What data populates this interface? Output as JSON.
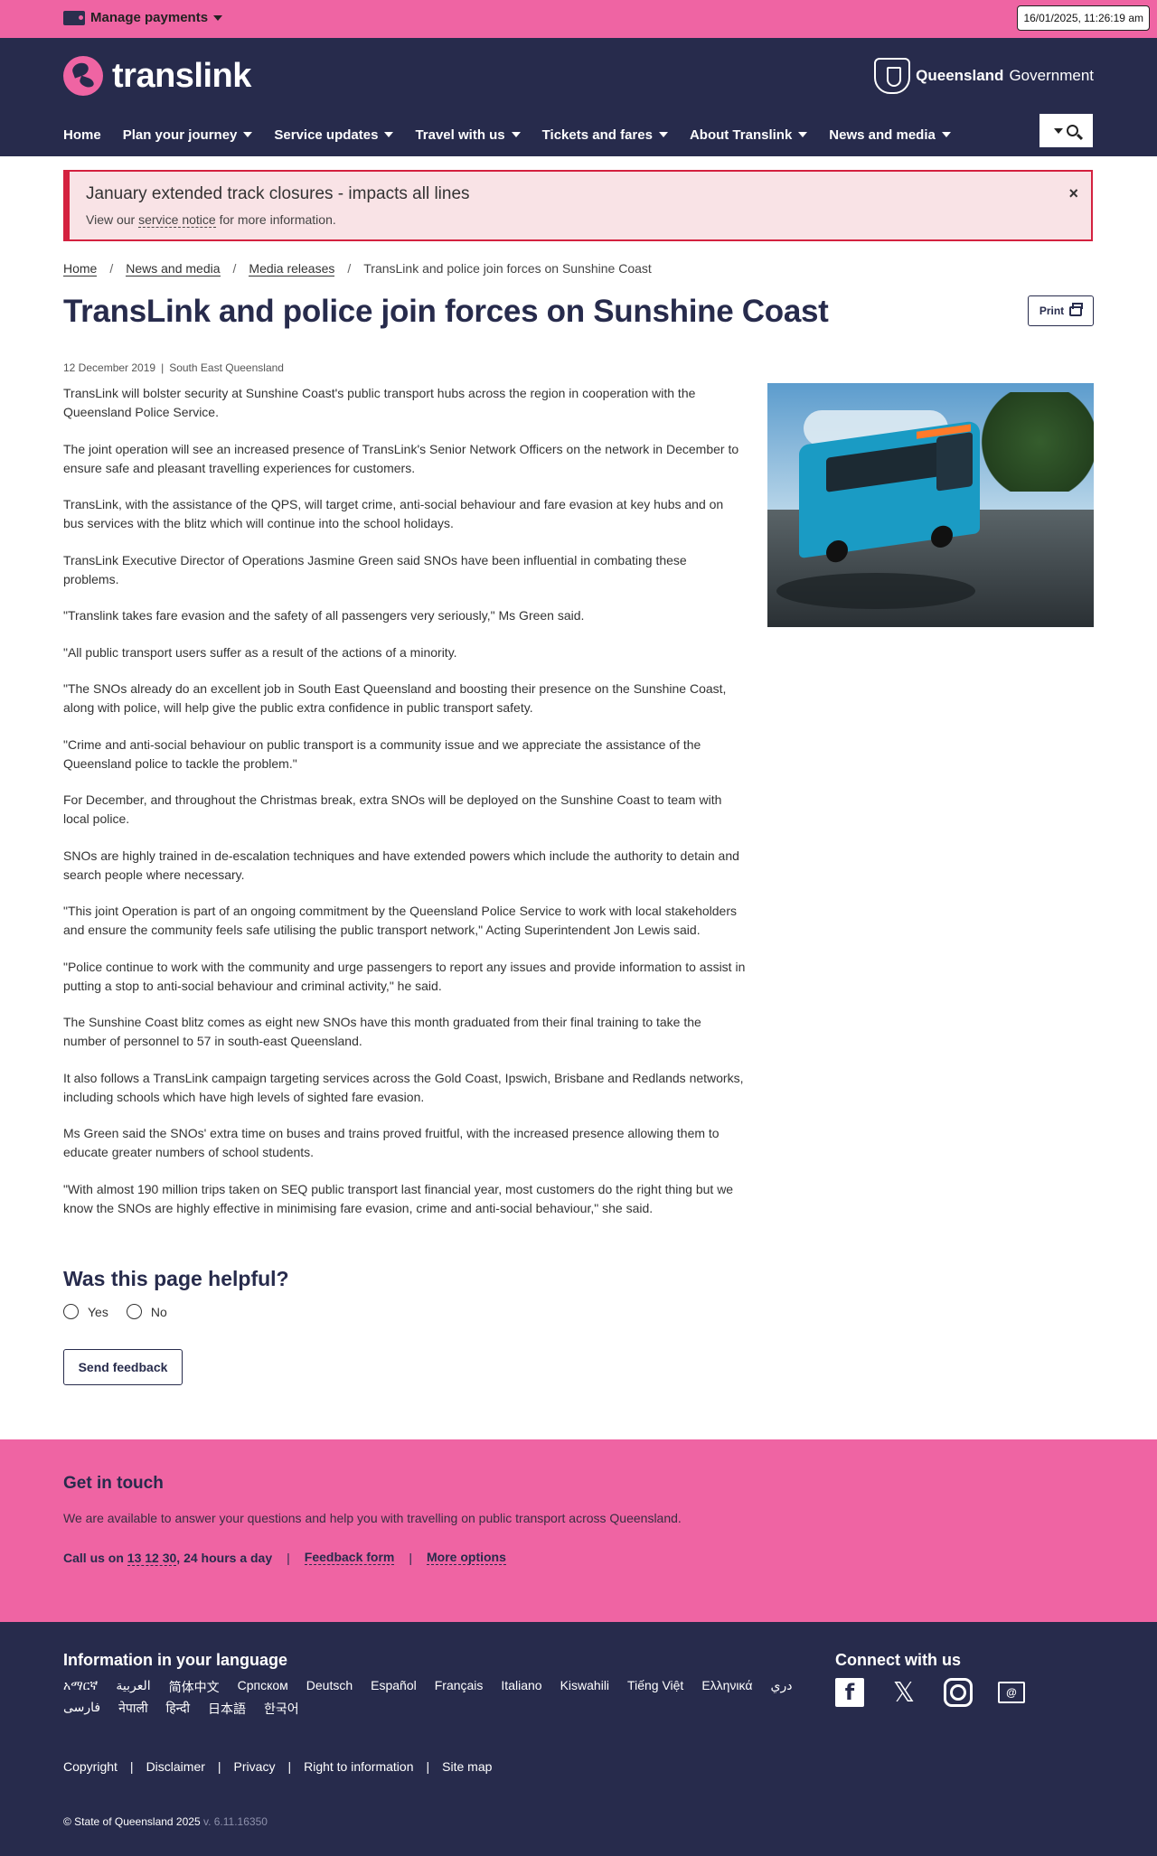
{
  "topbar": {
    "manage_payments": "Manage payments",
    "datetime": "16/01/2025, 11:26:19 am"
  },
  "header": {
    "logo_text": "translink",
    "gov_bold": "Queensland",
    "gov_rest": "Government",
    "nav": [
      "Home",
      "Plan your journey",
      "Service updates",
      "Travel with us",
      "Tickets and fares",
      "About Translink",
      "News and media"
    ]
  },
  "alert": {
    "title": "January extended track closures - impacts all lines",
    "text_before": "View our ",
    "link": "service notice",
    "text_after": " for more information.",
    "close": "×"
  },
  "breadcrumb": {
    "home": "Home",
    "news": "News and media",
    "releases": "Media releases",
    "current": "TransLink and police join forces on Sunshine Coast"
  },
  "article": {
    "title": "TransLink and police join forces on Sunshine Coast",
    "print_label": "Print",
    "date": "12 December 2019",
    "region": "South East Queensland",
    "paragraphs": [
      "TransLink will bolster security at Sunshine Coast's public transport hubs across the region in cooperation with the Queensland Police Service.",
      "The joint operation will see an increased presence of TransLink's Senior Network Officers on the network in December to ensure safe and pleasant travelling experiences for customers.",
      "TransLink, with the assistance of the QPS, will target crime, anti-social behaviour and fare evasion at key hubs and on bus services with the blitz which will continue into the school holidays.",
      "TransLink Executive Director of Operations Jasmine Green said SNOs have been influential in combating these problems.",
      "\"Translink takes fare evasion and the safety of all passengers very seriously,\" Ms Green said.",
      "\"All public transport users suffer as a result of the actions of a minority.",
      "\"The SNOs already do an excellent job in South East Queensland and boosting their presence on the Sunshine Coast, along with police, will help give the public extra confidence in public transport safety.",
      "\"Crime and anti-social behaviour on public transport is a community issue and we appreciate the assistance of the Queensland police to tackle the problem.\"",
      "For December, and throughout the Christmas break, extra SNOs will be deployed on the Sunshine Coast to team with local police.",
      "SNOs are highly trained in de-escalation techniques and have extended powers which include the authority to detain and search people where necessary.",
      "\"This joint Operation is part of an ongoing commitment by the Queensland Police Service to work with local stakeholders and ensure the community feels safe utilising the public transport network,\" Acting Superintendent Jon Lewis said.",
      "\"Police continue to work with the community and urge passengers to report any issues and provide information to assist in putting a stop to anti-social behaviour and criminal activity,\" he said.",
      "The Sunshine Coast blitz comes as eight new SNOs have this month graduated from their final training to take the number of personnel to 57 in south-east Queensland.",
      "It also follows a TransLink campaign targeting services across the Gold Coast, Ipswich, Brisbane and Redlands networks, including schools which have high levels of sighted fare evasion.",
      "Ms Green said the SNOs' extra time on buses and trains proved fruitful, with the increased presence allowing them to educate greater numbers of school students.",
      "\"With almost 190 million trips taken on SEQ public transport last financial year, most customers do the right thing but we know the SNOs are highly effective in minimising fare evasion, crime and anti-social behaviour,\" she said."
    ]
  },
  "feedback": {
    "title": "Was this page helpful?",
    "yes": "Yes",
    "no": "No",
    "send": "Send feedback"
  },
  "touch": {
    "title": "Get in touch",
    "text": "We are available to answer your questions and help you with travelling on public transport across Queensland.",
    "call_prefix": "Call us on ",
    "phone": "13 12 30",
    "call_suffix": ", 24 hours a day",
    "feedback_form": "Feedback form",
    "more_options": "More options"
  },
  "footer": {
    "lang_title": "Information in your language",
    "languages": [
      "አማርኛ",
      "العربية",
      "简体中文",
      "Српском",
      "Deutsch",
      "Español",
      "Français",
      "Italiano",
      "Kiswahili",
      "Tiếng Việt",
      "Ελληνικά",
      "دري",
      "فارسی",
      "नेपाली",
      "हिन्दी",
      "日本語",
      "한국어"
    ],
    "connect_title": "Connect with us",
    "links": [
      "Copyright",
      "Disclaimer",
      "Privacy",
      "Right to information",
      "Site map"
    ],
    "copyright": "© State of Queensland 2025",
    "version": "v. 6.11.16350"
  }
}
